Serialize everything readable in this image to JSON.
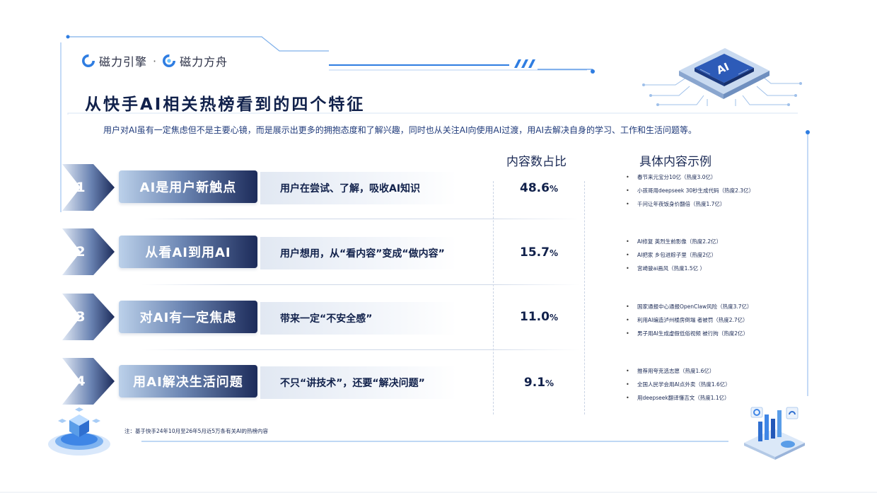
{
  "brand": {
    "name1": "磁力引擎",
    "separator": "·",
    "name2": "磁力方舟"
  },
  "title": "从快手AI相关热榜看到的四个特征",
  "subtitle": "用户对AI虽有一定焦虑但不是主要心镜，而是展示出更多的拥抱态度和了解兴趣，同时也从关注AI向使用AI过渡，用AI去解决自身的学习、工作和生活问题等。",
  "headers": {
    "share": "内容数占比",
    "examples": "具体内容示例"
  },
  "rows": [
    {
      "num": "1",
      "label": "AI是用户新触点",
      "desc": "用户在尝试、了解，吸收AI知识",
      "value": "48.6",
      "unit": "%",
      "examples": [
        "春节来元宝分10亿（热度3.0亿）",
        "小孩哥用deepseek 30秒生成代码（热度2.3亿）",
        "千问让年夜饭身价翻倍（热度1.7亿）"
      ]
    },
    {
      "num": "2",
      "label": "从看AI到用AI",
      "desc": "用户想用，从“看内容”变成“做内容”",
      "value": "15.7",
      "unit": "%",
      "examples": [
        "AI修复 英烈生前影像（热度2.2亿）",
        "AI把家 乡包进粽子里（热度2亿）",
        "宫崎骏ai画风（热度1.5亿 ）"
      ]
    },
    {
      "num": "3",
      "label": "对AI有一定焦虑",
      "desc": "带来一定“不安全感”",
      "value": "11.0",
      "unit": "%",
      "examples": [
        "国家通报中心通报OpenClaw风险（热度3.7亿）",
        "利用AI编造泸州楼房倒塌 者被罚（热度2.7亿）",
        "男子用AI生成虚假低俗视频 被行拘（热度2亿）"
      ]
    },
    {
      "num": "4",
      "label": "用AI解决生活问题",
      "desc": "不只“讲技术”，还要“解决问题”",
      "value": "9.1",
      "unit": "%",
      "examples": [
        "推荐用夸克选志愿（热度1.6亿）",
        "全国人民学会用AI点外卖（热度1.6亿）",
        "用deepseek翻译懂吉文（热度1.1亿）"
      ]
    }
  ],
  "note": "注：基于快手24年10月至26年5月近5万条有关AI的热榜内容",
  "colors": {
    "accent": "#2f7de1",
    "navy": "#1c2b5a",
    "light_blue": "#bcd1ea"
  },
  "decor": {
    "chip_icon": "ai-chip-illustration",
    "cube_icon": "blockchain-cube-illustration",
    "chart_icon": "data-chart-illustration"
  },
  "icons": {
    "chip_text": "AI"
  }
}
